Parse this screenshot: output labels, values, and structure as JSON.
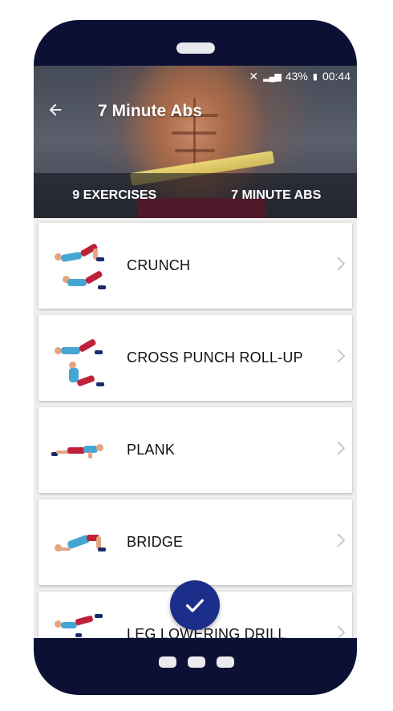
{
  "status_bar": {
    "battery": "43%",
    "time": "00:44"
  },
  "header": {
    "title": "7 Minute Abs",
    "back_icon": "arrow-left-icon"
  },
  "summary": {
    "exercises": "9 EXERCISES",
    "program": "7 MINUTE ABS"
  },
  "exercises": [
    {
      "label": "CRUNCH"
    },
    {
      "label": "CROSS PUNCH ROLL-UP"
    },
    {
      "label": "PLANK"
    },
    {
      "label": "BRIDGE"
    },
    {
      "label": "LEG LOWERING DRILL"
    }
  ],
  "fab": {
    "icon": "checkmark-icon"
  },
  "colors": {
    "phone_body": "#0b1034",
    "fab": "#1b2f8a",
    "accent_red": "#c0213a",
    "accent_blue": "#45a6d4"
  }
}
